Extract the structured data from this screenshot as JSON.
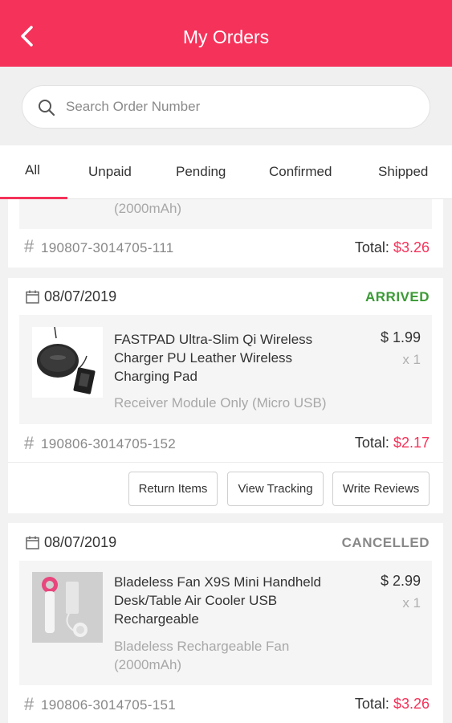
{
  "header": {
    "title": "My Orders"
  },
  "search": {
    "placeholder": "Search Order Number"
  },
  "tabs": [
    "All",
    "Unpaid",
    "Pending",
    "Confirmed",
    "Shipped"
  ],
  "orders": [
    {
      "variant": "(2000mAh)",
      "order_number": "190807-3014705-111",
      "total_label": "Total:",
      "total": "$3.26"
    },
    {
      "date": "08/07/2019",
      "status": "ARRIVED",
      "status_color": "#3a9a34",
      "product": "FASTPAD Ultra-Slim Qi Wireless Charger PU Leather Wireless Charging Pad",
      "variant": "Receiver Module Only (Micro USB)",
      "price": "$ 1.99",
      "qty": "x 1",
      "order_number": "190806-3014705-152",
      "total_label": "Total:",
      "total": "$2.17",
      "actions": [
        "Return Items",
        "View Tracking",
        "Write Reviews"
      ]
    },
    {
      "date": "08/07/2019",
      "status": "CANCELLED",
      "status_color": "#888888",
      "product": "Bladeless Fan X9S Mini Handheld Desk/Table Air Cooler USB Rechargeable",
      "variant": "Bladeless Rechargeable Fan (2000mAh)",
      "price": "$ 2.99",
      "qty": "x 1",
      "order_number": "190806-3014705-151",
      "total_label": "Total:",
      "total": "$3.26"
    }
  ],
  "colors": {
    "accent": "#f5325a",
    "arrived": "#3a9a34",
    "cancelled": "#888888"
  },
  "icons": [
    "back-arrow-icon",
    "search-icon",
    "calendar-icon",
    "hash-icon",
    "charger-product-image",
    "fan-product-image"
  ]
}
